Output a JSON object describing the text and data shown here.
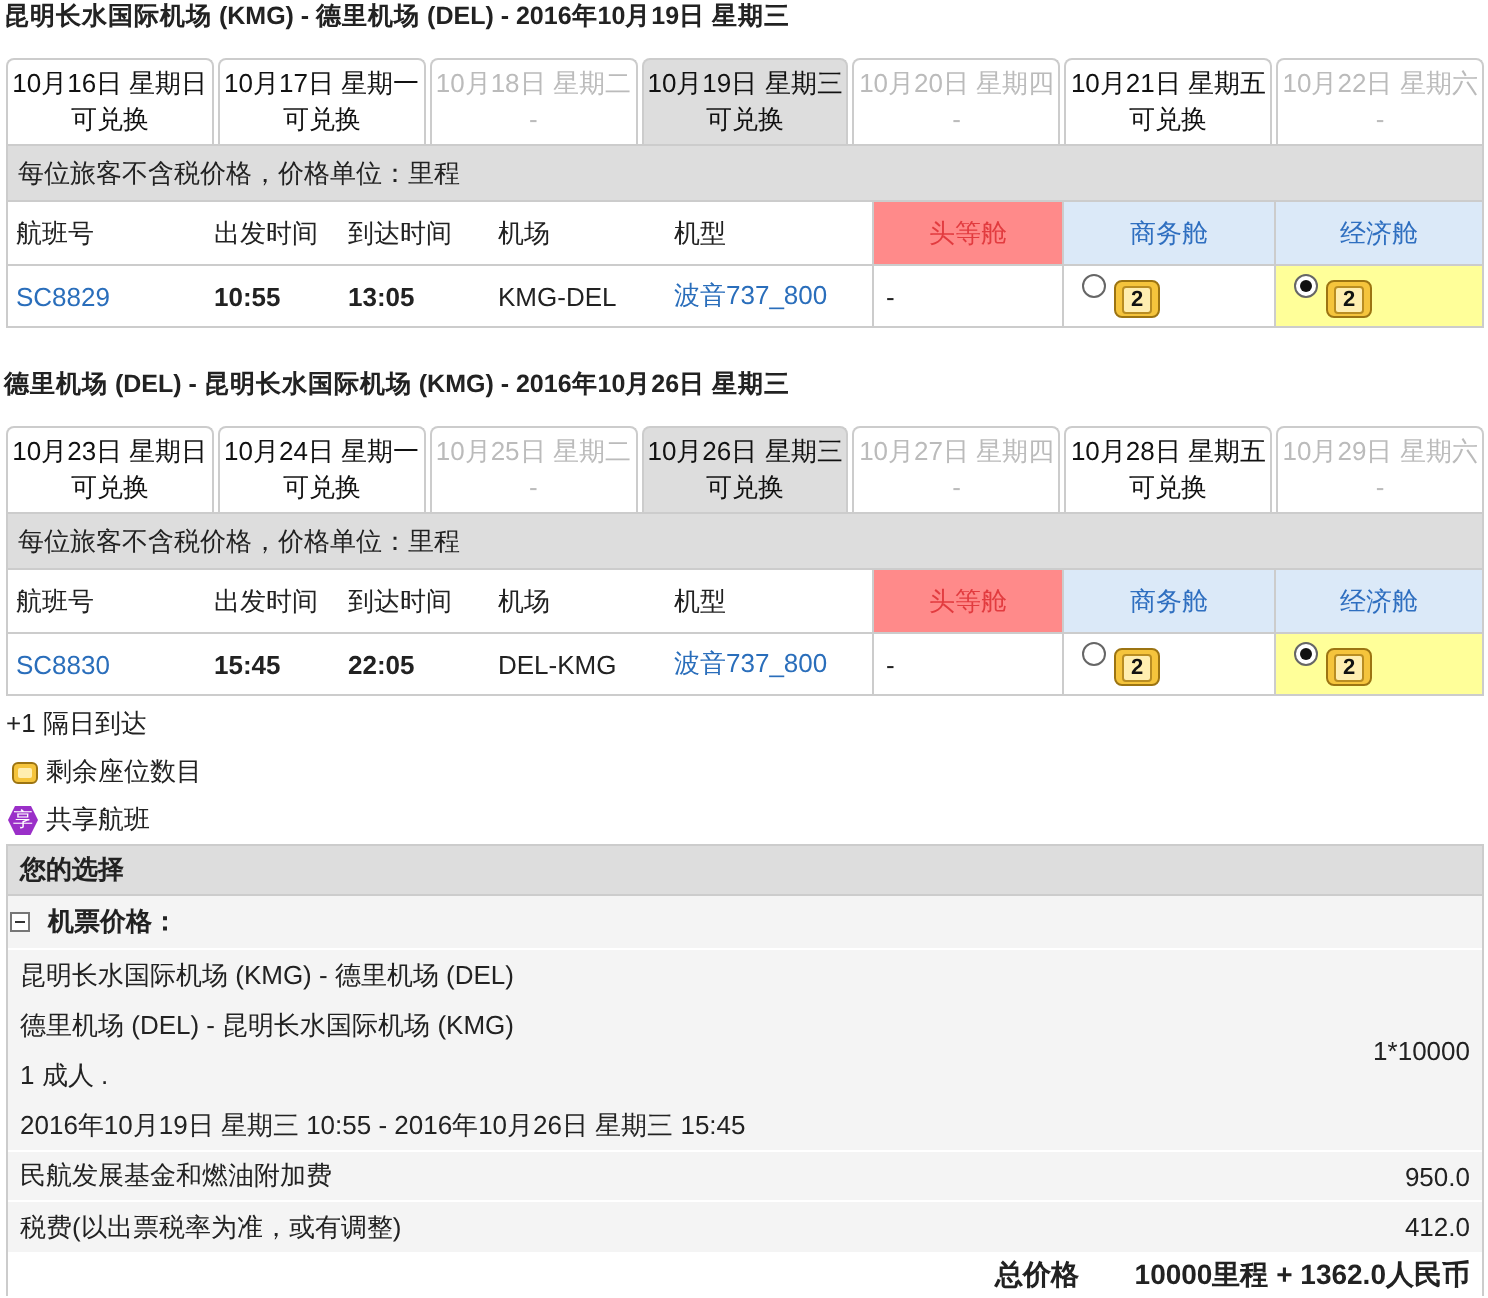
{
  "segments": [
    {
      "title": "昆明长水国际机场 (KMG) - 德里机场 (DEL) - 2016年10月19日 星期三",
      "date_tabs": [
        {
          "date": "10月16日 星期日",
          "status": "可兑换",
          "available": true,
          "selected": false
        },
        {
          "date": "10月17日 星期一",
          "status": "可兑换",
          "available": true,
          "selected": false
        },
        {
          "date": "10月18日 星期二",
          "status": "-",
          "available": false,
          "selected": false
        },
        {
          "date": "10月19日 星期三",
          "status": "可兑换",
          "available": true,
          "selected": true
        },
        {
          "date": "10月20日 星期四",
          "status": "-",
          "available": false,
          "selected": false
        },
        {
          "date": "10月21日 星期五",
          "status": "可兑换",
          "available": true,
          "selected": false
        },
        {
          "date": "10月22日 星期六",
          "status": "-",
          "available": false,
          "selected": false
        }
      ],
      "price_note": "每位旅客不含税价格，价格单位：里程",
      "columns": [
        "航班号",
        "出发时间",
        "到达时间",
        "机场",
        "机型"
      ],
      "cabins": [
        {
          "name": "头等舱",
          "kind": "first"
        },
        {
          "name": "商务舱",
          "kind": "business"
        },
        {
          "name": "经济舱",
          "kind": "economy"
        }
      ],
      "flights": [
        {
          "number": "SC8829",
          "depart": "10:55",
          "arrive": "13:05",
          "airport": "KMG-DEL",
          "aircraft": "波音737_800",
          "fares": [
            {
              "kind": "none",
              "text": "-"
            },
            {
              "kind": "option",
              "selected": false,
              "seats": "2"
            },
            {
              "kind": "option",
              "selected": true,
              "seats": "2"
            }
          ]
        }
      ]
    },
    {
      "title": "德里机场 (DEL) - 昆明长水国际机场 (KMG) - 2016年10月26日 星期三",
      "date_tabs": [
        {
          "date": "10月23日 星期日",
          "status": "可兑换",
          "available": true,
          "selected": false
        },
        {
          "date": "10月24日 星期一",
          "status": "可兑换",
          "available": true,
          "selected": false
        },
        {
          "date": "10月25日 星期二",
          "status": "-",
          "available": false,
          "selected": false
        },
        {
          "date": "10月26日 星期三",
          "status": "可兑换",
          "available": true,
          "selected": true
        },
        {
          "date": "10月27日 星期四",
          "status": "-",
          "available": false,
          "selected": false
        },
        {
          "date": "10月28日 星期五",
          "status": "可兑换",
          "available": true,
          "selected": false
        },
        {
          "date": "10月29日 星期六",
          "status": "-",
          "available": false,
          "selected": false
        }
      ],
      "price_note": "每位旅客不含税价格，价格单位：里程",
      "columns": [
        "航班号",
        "出发时间",
        "到达时间",
        "机场",
        "机型"
      ],
      "cabins": [
        {
          "name": "头等舱",
          "kind": "first"
        },
        {
          "name": "商务舱",
          "kind": "business"
        },
        {
          "name": "经济舱",
          "kind": "economy"
        }
      ],
      "flights": [
        {
          "number": "SC8830",
          "depart": "15:45",
          "arrive": "22:05",
          "airport": "DEL-KMG",
          "aircraft": "波音737_800",
          "fares": [
            {
              "kind": "none",
              "text": "-"
            },
            {
              "kind": "option",
              "selected": false,
              "seats": "2"
            },
            {
              "kind": "option",
              "selected": true,
              "seats": "2"
            }
          ]
        }
      ]
    }
  ],
  "legend": [
    {
      "kind": "plain",
      "text": "+1 隔日到达"
    },
    {
      "kind": "seats",
      "text": "剩余座位数目"
    },
    {
      "kind": "shared",
      "badge": "享",
      "text": "共享航班"
    }
  ],
  "selection": {
    "title": "您的选择",
    "section": {
      "label": "机票价格：",
      "expanded": true
    },
    "details": [
      "昆明长水国际机场 (KMG) - 德里机场 (DEL)",
      "德里机场 (DEL) - 昆明长水国际机场 (KMG)",
      "1 成人 .",
      "2016年10月19日 星期三 10:55 - 2016年10月26日 星期三 15:45"
    ],
    "fare_amount": "1*10000",
    "fees": [
      {
        "label": "民航发展基金和燃油附加费",
        "amount": "950.0"
      },
      {
        "label": "税费(以出票税率为准，或有调整)",
        "amount": "412.0"
      }
    ],
    "total": {
      "label": "总价格",
      "value": "10000里程 + 1362.0人民币"
    }
  }
}
